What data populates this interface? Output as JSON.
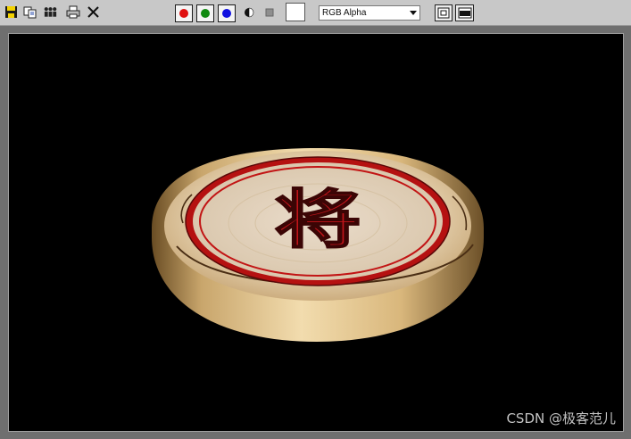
{
  "toolbar": {
    "icons": [
      {
        "name": "save-icon"
      },
      {
        "name": "copy-icon"
      },
      {
        "name": "clone-icon"
      },
      {
        "name": "print-icon"
      },
      {
        "name": "clear-icon"
      }
    ],
    "channels": [
      {
        "name": "red-channel-button",
        "color": "#e01010"
      },
      {
        "name": "green-channel-button",
        "color": "#108a10"
      },
      {
        "name": "blue-channel-button",
        "color": "#1010e0"
      }
    ],
    "display_mode": {
      "selected": "RGB Alpha"
    }
  },
  "render": {
    "glyph": "将"
  },
  "watermark": {
    "text": "CSDN @极客范儿"
  },
  "colors": {
    "toolbar_bg": "#c8c8c8",
    "frame_bg": "#6f6f6f",
    "viewport_bg": "#000000",
    "piece_wood": "#e3c48e",
    "piece_ring": "#d01818"
  }
}
